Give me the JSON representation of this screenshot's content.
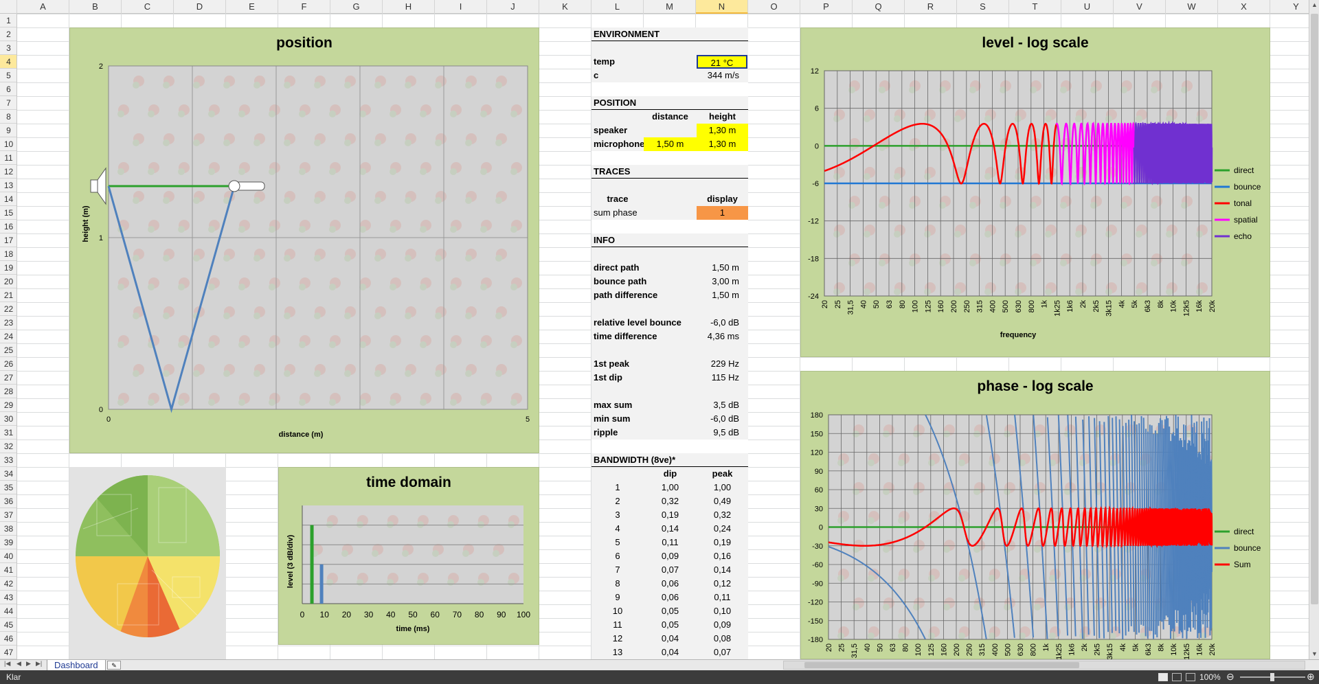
{
  "columns": [
    "A",
    "B",
    "C",
    "D",
    "E",
    "F",
    "G",
    "H",
    "I",
    "J",
    "K",
    "L",
    "M",
    "N",
    "O",
    "P",
    "Q",
    "R",
    "S",
    "T",
    "U",
    "V",
    "W",
    "X",
    "Y"
  ],
  "selected_column": "N",
  "rows": [
    "1",
    "2",
    "3",
    "4",
    "5",
    "6",
    "7",
    "8",
    "9",
    "10",
    "11",
    "12",
    "13",
    "14",
    "15",
    "16",
    "17",
    "18",
    "19",
    "20",
    "21",
    "22",
    "23",
    "24",
    "25",
    "26",
    "27",
    "28",
    "29",
    "30",
    "31",
    "32",
    "33",
    "34",
    "35",
    "36",
    "37",
    "38",
    "39",
    "40",
    "41",
    "42",
    "43",
    "44",
    "45",
    "46",
    "47"
  ],
  "selected_row": "4",
  "position_chart": {
    "title": "position",
    "xlabel": "distance (m)",
    "ylabel": "height (m)",
    "x_ticks": [
      "0",
      "5"
    ],
    "y_ticks": [
      "0",
      "1",
      "2"
    ],
    "xlim": [
      0,
      5
    ],
    "ylim": [
      0,
      2
    ],
    "colors": {
      "direct": "#2ca02c",
      "bounce": "#4f81bd"
    }
  },
  "time_domain_chart": {
    "title": "time domain",
    "xlabel": "time (ms)",
    "ylabel": "level (3 dB/div)",
    "x_ticks": [
      "0",
      "10",
      "20",
      "30",
      "40",
      "50",
      "60",
      "70",
      "80",
      "90",
      "100"
    ],
    "xlim": [
      0,
      100
    ]
  },
  "environment": {
    "header": "ENVIRONMENT",
    "temp_label": "temp",
    "temp_value": "21 °C",
    "c_label": "c",
    "c_value": "344 m/s"
  },
  "position": {
    "header": "POSITION",
    "col_distance": "distance",
    "col_height": "height",
    "speaker_label": "speaker",
    "speaker_height": "1,30 m",
    "microphone_label": "microphone",
    "microphone_distance": "1,50 m",
    "microphone_height": "1,30 m"
  },
  "traces": {
    "header": "TRACES",
    "col_trace": "trace",
    "col_display": "display",
    "trace_name": "sum phase",
    "display_value": "1"
  },
  "info": {
    "header": "INFO",
    "items": [
      {
        "label": "direct path",
        "value": "1,50 m"
      },
      {
        "label": "bounce path",
        "value": "3,00 m"
      },
      {
        "label": "path difference",
        "value": "1,50 m"
      },
      {
        "label": "relative level bounce",
        "value": "-6,0 dB"
      },
      {
        "label": "time difference",
        "value": "4,36 ms"
      },
      {
        "label": "1st peak",
        "value": "229 Hz"
      },
      {
        "label": "1st dip",
        "value": "115 Hz"
      },
      {
        "label": "max sum",
        "value": "3,5 dB"
      },
      {
        "label": "min sum",
        "value": "-6,0 dB"
      },
      {
        "label": "ripple",
        "value": "9,5 dB"
      }
    ]
  },
  "bandwidth": {
    "header": "BANDWIDTH (8ve)*",
    "col_dip": "dip",
    "col_peak": "peak",
    "rows": [
      {
        "n": "1",
        "dip": "1,00",
        "peak": "1,00"
      },
      {
        "n": "2",
        "dip": "0,32",
        "peak": "0,49"
      },
      {
        "n": "3",
        "dip": "0,19",
        "peak": "0,32"
      },
      {
        "n": "4",
        "dip": "0,14",
        "peak": "0,24"
      },
      {
        "n": "5",
        "dip": "0,11",
        "peak": "0,19"
      },
      {
        "n": "6",
        "dip": "0,09",
        "peak": "0,16"
      },
      {
        "n": "7",
        "dip": "0,07",
        "peak": "0,14"
      },
      {
        "n": "8",
        "dip": "0,06",
        "peak": "0,12"
      },
      {
        "n": "9",
        "dip": "0,06",
        "peak": "0,11"
      },
      {
        "n": "10",
        "dip": "0,05",
        "peak": "0,10"
      },
      {
        "n": "11",
        "dip": "0,05",
        "peak": "0,09"
      },
      {
        "n": "12",
        "dip": "0,04",
        "peak": "0,08"
      },
      {
        "n": "13",
        "dip": "0,04",
        "peak": "0,07"
      }
    ]
  },
  "level_chart": {
    "title": "level - log scale",
    "xlabel": "frequency",
    "y_ticks": [
      "12",
      "6",
      "0",
      "-6",
      "-12",
      "-18",
      "-24"
    ],
    "ylim": [
      -24,
      12
    ],
    "x_ticks": [
      "20",
      "25",
      "31,5",
      "40",
      "50",
      "63",
      "80",
      "100",
      "125",
      "160",
      "200",
      "250",
      "315",
      "400",
      "500",
      "630",
      "800",
      "1k",
      "1k25",
      "1k6",
      "2k",
      "2k5",
      "3k15",
      "4k",
      "5k",
      "6k3",
      "8k",
      "10k",
      "12k5",
      "16k",
      "20k"
    ],
    "legend": [
      {
        "name": "direct",
        "color": "#2ca02c"
      },
      {
        "name": "bounce",
        "color": "#1f77d4"
      },
      {
        "name": "tonal",
        "color": "#ff0000"
      },
      {
        "name": "spatial",
        "color": "#ff00ff"
      },
      {
        "name": "echo",
        "color": "#7030d0"
      }
    ]
  },
  "phase_chart": {
    "title": "phase - log scale",
    "y_ticks": [
      "180",
      "150",
      "120",
      "90",
      "60",
      "30",
      "0",
      "-30",
      "-60",
      "-90",
      "-120",
      "-150",
      "-180"
    ],
    "ylim": [
      -180,
      180
    ],
    "x_ticks": [
      "20",
      "25",
      "31,5",
      "40",
      "50",
      "63",
      "80",
      "100",
      "125",
      "160",
      "200",
      "250",
      "315",
      "400",
      "500",
      "630",
      "800",
      "1k",
      "1k25",
      "1k6",
      "2k",
      "2k5",
      "3k15",
      "4k",
      "5k",
      "6k3",
      "8k",
      "10k",
      "12k5",
      "16k",
      "20k"
    ],
    "legend": [
      {
        "name": "direct",
        "color": "#2ca02c"
      },
      {
        "name": "bounce",
        "color": "#4f81bd"
      },
      {
        "name": "Sum",
        "color": "#ff0000"
      }
    ]
  },
  "chart_data": [
    {
      "type": "line",
      "title": "position",
      "xlabel": "distance (m)",
      "ylabel": "height (m)",
      "xlim": [
        0,
        5
      ],
      "ylim": [
        0,
        2
      ],
      "series": [
        {
          "name": "direct",
          "x": [
            0,
            1.5
          ],
          "y": [
            1.3,
            1.3
          ]
        },
        {
          "name": "bounce",
          "x": [
            0,
            0.75,
            1.5
          ],
          "y": [
            1.3,
            0,
            1.3
          ]
        }
      ]
    },
    {
      "type": "bar",
      "title": "time domain",
      "xlabel": "time (ms)",
      "ylabel": "level (3 dB/div)",
      "xlim": [
        0,
        100
      ],
      "series": [
        {
          "name": "direct",
          "x": [
            4.36
          ],
          "y": [
            4
          ]
        },
        {
          "name": "bounce",
          "x": [
            8.72
          ],
          "y": [
            2
          ]
        }
      ]
    },
    {
      "type": "line",
      "title": "level - log scale",
      "xlabel": "frequency",
      "ylim": [
        -24,
        12
      ],
      "x_scale": "log",
      "series": [
        {
          "name": "direct",
          "constant": 0
        },
        {
          "name": "bounce",
          "constant": -6
        },
        {
          "name": "tonal",
          "fmax": 1250
        },
        {
          "name": "spatial",
          "fmin": 1250,
          "fmax": 5000
        },
        {
          "name": "echo",
          "fmin": 5000
        }
      ],
      "max_sum": 3.5,
      "min_sum": -6.0,
      "first_dip_hz": 115,
      "first_peak_hz": 229
    },
    {
      "type": "line",
      "title": "phase - log scale",
      "ylim": [
        -180,
        180
      ],
      "x_scale": "log",
      "series": [
        {
          "name": "direct",
          "constant": 0
        },
        {
          "name": "bounce"
        },
        {
          "name": "Sum"
        }
      ]
    }
  ],
  "sheet_tab": "Dashboard",
  "status": {
    "mode": "Klar",
    "zoom": "100%"
  }
}
